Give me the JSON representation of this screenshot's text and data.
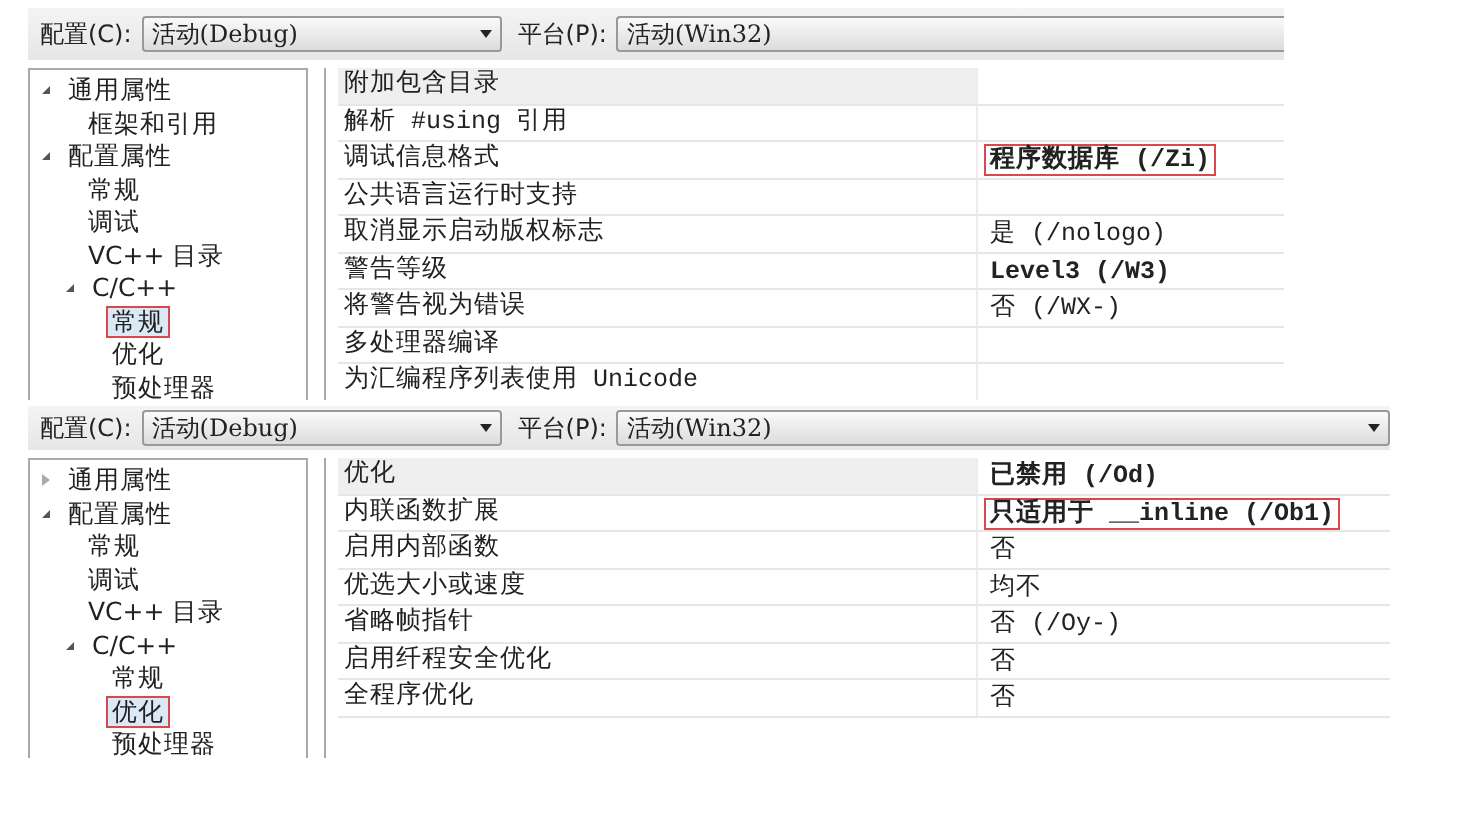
{
  "panels": [
    {
      "config": {
        "label": "配置(C):",
        "value": "活动(Debug)"
      },
      "platform": {
        "label": "平台(P):",
        "value": "活动(Win32)",
        "arrow": false
      },
      "tree": [
        {
          "label": "通用属性",
          "expanded": true,
          "selected": false,
          "children": [
            {
              "label": "框架和引用",
              "selected": false
            }
          ]
        },
        {
          "label": "配置属性",
          "expanded": true,
          "selected": false,
          "children": [
            {
              "label": "常规",
              "selected": false
            },
            {
              "label": "调试",
              "selected": false
            },
            {
              "label": "VC++ 目录",
              "selected": false
            },
            {
              "label": "C/C++",
              "expanded": true,
              "selected": false,
              "children": [
                {
                  "label": "常规",
                  "selected": true
                },
                {
                  "label": "优化",
                  "selected": false
                },
                {
                  "label": "预处理器",
                  "selected": false
                }
              ]
            }
          ]
        }
      ],
      "rows": [
        {
          "name": "附加包含目录",
          "selected": true
        },
        {
          "name": "解析 #using 引用",
          "selected": false
        },
        {
          "name": "调试信息格式",
          "value": "程序数据库 (/Zi)",
          "selected": false,
          "bold": true,
          "highlighted": true
        },
        {
          "name": "公共语言运行时支持",
          "selected": false
        },
        {
          "name": "取消显示启动版权标志",
          "value": "是 (/nologo)",
          "selected": false,
          "bold": false,
          "highlighted": false
        },
        {
          "name": "警告等级",
          "value": "Level3 (/W3)",
          "selected": false,
          "bold": true,
          "highlighted": false
        },
        {
          "name": "将警告视为错误",
          "value": "否 (/WX-)",
          "selected": false,
          "bold": false,
          "highlighted": false
        },
        {
          "name": "多处理器编译",
          "selected": false
        },
        {
          "name": "为汇编程序列表使用 Unicode",
          "selected": false
        }
      ]
    },
    {
      "config": {
        "label": "配置(C):",
        "value": "活动(Debug)"
      },
      "platform": {
        "label": "平台(P):",
        "value": "活动(Win32)",
        "arrow": true
      },
      "tree": [
        {
          "label": "通用属性",
          "expanded": false,
          "selected": false
        },
        {
          "label": "配置属性",
          "expanded": true,
          "selected": false,
          "children": [
            {
              "label": "常规",
              "selected": false
            },
            {
              "label": "调试",
              "selected": false
            },
            {
              "label": "VC++ 目录",
              "selected": false
            },
            {
              "label": "C/C++",
              "expanded": true,
              "selected": false,
              "children": [
                {
                  "label": "常规",
                  "selected": false
                },
                {
                  "label": "优化",
                  "selected": true
                },
                {
                  "label": "预处理器",
                  "selected": false
                }
              ]
            }
          ]
        }
      ],
      "rows": [
        {
          "name": "优化",
          "value": "已禁用 (/Od)",
          "selected": true,
          "bold": true,
          "highlighted": false
        },
        {
          "name": "内联函数扩展",
          "value": "只适用于 __inline (/Ob1)",
          "selected": false,
          "bold": true,
          "highlighted": true
        },
        {
          "name": "启用内部函数",
          "value": "否",
          "selected": false,
          "bold": false,
          "highlighted": false
        },
        {
          "name": "优选大小或速度",
          "value": "均不",
          "selected": false,
          "bold": false,
          "highlighted": false
        },
        {
          "name": "省略帧指针",
          "value": "否 (/Oy-)",
          "selected": false,
          "bold": false,
          "highlighted": false
        },
        {
          "name": "启用纤程安全优化",
          "value": "否",
          "selected": false,
          "bold": false,
          "highlighted": false
        },
        {
          "name": "全程序优化",
          "value": "否",
          "selected": false,
          "bold": false,
          "highlighted": false
        }
      ]
    }
  ]
}
